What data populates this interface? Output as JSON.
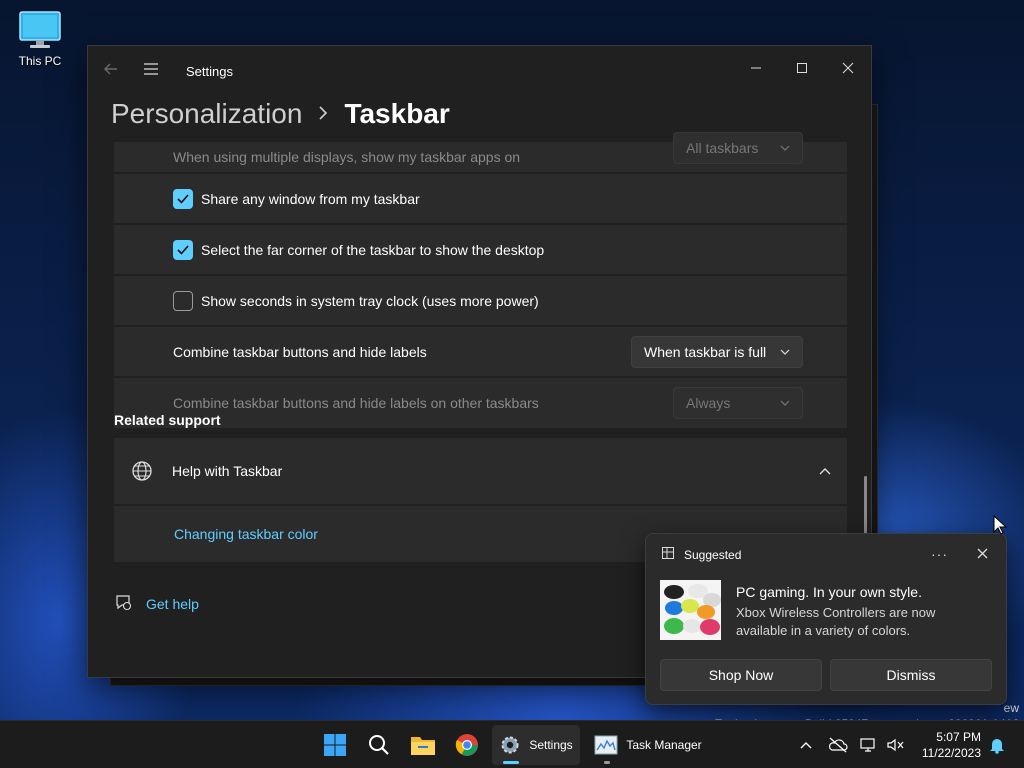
{
  "desktop": {
    "icon_label": "This PC"
  },
  "window": {
    "title": "Settings",
    "breadcrumb_parent": "Personalization",
    "breadcrumb_current": "Taskbar"
  },
  "settings": {
    "multi_display_label": "When using multiple displays, show my taskbar apps on",
    "multi_display_value": "All taskbars",
    "share_window_label": "Share any window from my taskbar",
    "share_window_checked": true,
    "far_corner_label": "Select the far corner of the taskbar to show the desktop",
    "far_corner_checked": true,
    "show_seconds_label": "Show seconds in system tray clock (uses more power)",
    "show_seconds_checked": false,
    "combine_label": "Combine taskbar buttons and hide labels",
    "combine_value": "When taskbar is full",
    "combine_other_label": "Combine taskbar buttons and hide labels on other taskbars",
    "combine_other_value": "Always"
  },
  "related": {
    "title": "Related support",
    "help_label": "Help with Taskbar",
    "link_label": "Changing taskbar color",
    "get_help": "Get help"
  },
  "toast": {
    "app_name": "Suggested",
    "heading": "PC gaming. In your own style.",
    "body": "Xbox Wireless Controllers are now available in a variety of colors.",
    "primary_button": "Shop Now",
    "secondary_button": "Dismiss"
  },
  "watermark": {
    "line1": "ew",
    "line2": "Evaluation copy. Build 25947.rs_prerelease.230901-1416"
  },
  "taskbar": {
    "settings_label": "Settings",
    "taskmanager_label": "Task Manager",
    "time": "5:07 PM",
    "date": "11/22/2023"
  },
  "colors": {
    "accent": "#60cdff",
    "window_bg": "#202020",
    "card_bg": "#2b2b2b"
  }
}
